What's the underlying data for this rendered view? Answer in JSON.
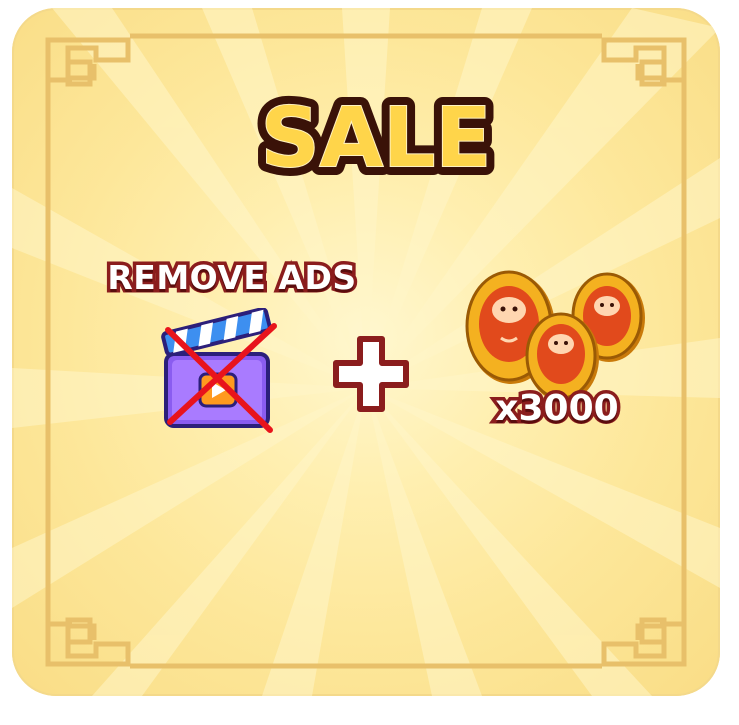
{
  "offer": {
    "title": "SALE",
    "remove_ads_label": "REMOVE ADS",
    "coin_quantity": "x3000"
  },
  "icons": {
    "ads": "film-clapperboard-icon",
    "cross": "red-x-icon",
    "plus": "plus-icon",
    "coins": "daruma-coin-icon"
  },
  "colors": {
    "panel_background": "#fde79a",
    "title_fill": "#f6b928",
    "outline": "#8b1d1d",
    "frame": "#e8c06a",
    "coin_gold": "#f4b120",
    "coin_red": "#e14a1c"
  }
}
